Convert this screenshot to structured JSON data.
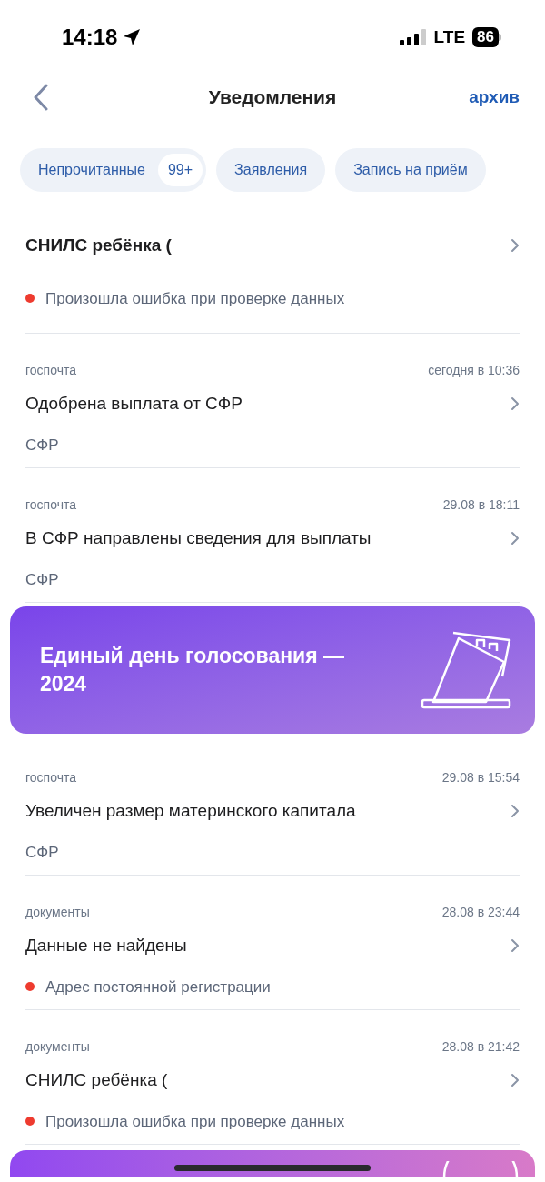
{
  "status_bar": {
    "time": "14:18",
    "network": "LTE",
    "battery": "86"
  },
  "header": {
    "title": "Уведомления",
    "action": "архив"
  },
  "tabs": [
    {
      "label": "Непрочитанные",
      "badge": "99+",
      "selected": false
    },
    {
      "label": "Заявления",
      "selected": false
    },
    {
      "label": "Запись на приём",
      "selected": false
    }
  ],
  "feed": [
    {
      "kind": "notification",
      "title": "СНИЛС ребёнка (",
      "unread": true,
      "note": "Произошла ошибка при проверке данных",
      "color": "#ee3b2f"
    },
    {
      "kind": "notification",
      "category": "госпочта",
      "time": "сегодня в 10:36",
      "title": "Одобрена выплата от СФР",
      "unread": false,
      "note": "СФР"
    },
    {
      "kind": "notification",
      "category": "госпочта",
      "time": "29.08 в 18:11",
      "title": "В СФР направлены сведения для выплаты",
      "unread": false,
      "note": "СФР"
    },
    {
      "kind": "banner",
      "title": "Единый день голосования — 2024"
    },
    {
      "kind": "notification",
      "category": "госпочта",
      "time": "29.08 в 15:54",
      "title": "Увеличен размер материнского капитала",
      "unread": false,
      "note": "СФР"
    },
    {
      "kind": "notification",
      "category": "документы",
      "time": "28.08 в 23:44",
      "title": "Данные не найдены",
      "unread": false,
      "note": "Адрес постоянной регистрации",
      "color": "#ee3b2f"
    },
    {
      "kind": "notification",
      "category": "документы",
      "time": "28.08 в 21:42",
      "title": "СНИЛС ребёнка (",
      "unread": false,
      "note": "Произошла ошибка при проверке данных",
      "color": "#ee3b2f"
    },
    {
      "kind": "promo"
    }
  ]
}
